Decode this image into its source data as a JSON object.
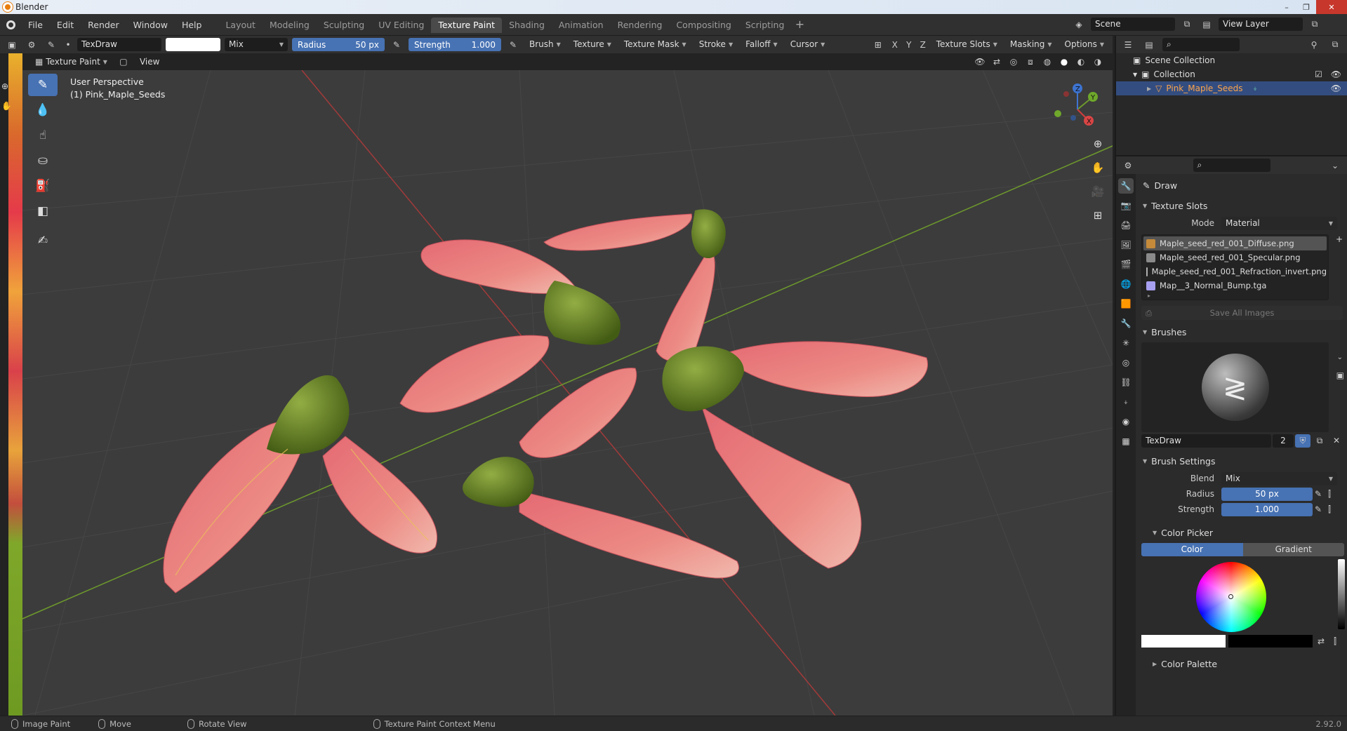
{
  "window": {
    "title": "Blender",
    "controls": [
      "–",
      "❐",
      "✕"
    ]
  },
  "menubar": {
    "menus": [
      "File",
      "Edit",
      "Render",
      "Window",
      "Help"
    ],
    "workspaces": [
      "Layout",
      "Modeling",
      "Sculpting",
      "UV Editing",
      "Texture Paint",
      "Shading",
      "Animation",
      "Rendering",
      "Compositing",
      "Scripting"
    ],
    "active_workspace": "Texture Paint",
    "add_tab": "+",
    "scene_label": "Scene",
    "view_layer_label": "View Layer"
  },
  "toolheader": {
    "brush_name": "TexDraw",
    "blend_mode": "Mix",
    "radius_label": "Radius",
    "radius_value": "50 px",
    "strength_label": "Strength",
    "strength_value": "1.000",
    "brush_menu": "Brush",
    "texture_menu": "Texture",
    "texture_mask_menu": "Texture Mask",
    "stroke_menu": "Stroke",
    "falloff_menu": "Falloff",
    "cursor_menu": "Cursor",
    "axis_x": "X",
    "axis_y": "Y",
    "axis_z": "Z",
    "texture_slots_menu": "Texture Slots",
    "masking_menu": "Masking",
    "options_menu": "Options"
  },
  "viewport_header": {
    "mode": "Texture Paint",
    "view_menu": "View"
  },
  "viewport": {
    "perspective": "User Perspective",
    "object_info": "(1) Pink_Maple_Seeds",
    "gizmo_x": "X",
    "gizmo_y": "Y",
    "gizmo_z": "Z",
    "colors": {
      "bg": "#3c3c3c",
      "grid": "#454545",
      "x_axis": "#a33a3a",
      "y_axis": "#6e9a2c",
      "wing": "#e8727a",
      "wing_edge": "#f2b3a8",
      "seed": "#5e7a22",
      "vein": "#e9c05a"
    }
  },
  "tools": [
    "draw-brush-icon",
    "soften-icon",
    "smear-icon",
    "clone-stamp-icon",
    "fill-bucket-icon",
    "mask-icon",
    "annotate-icon"
  ],
  "outliner": {
    "scene_collection": "Scene Collection",
    "collection": "Collection",
    "object": "Pink_Maple_Seeds"
  },
  "properties": {
    "tool_name": "Draw",
    "texture_slots": {
      "title": "Texture Slots",
      "mode_label": "Mode",
      "mode_value": "Material",
      "slots": [
        "Maple_seed_red_001_Diffuse.png",
        "Maple_seed_red_001_Specular.png",
        "Maple_seed_red_001_Refraction_invert.png",
        "Map__3_Normal_Bump.tga"
      ],
      "slot_colors": [
        "#c58a3a",
        "#8a8a8a",
        "#b0b0b0",
        "#a79ff0"
      ],
      "save_all": "Save All Images"
    },
    "brushes": {
      "title": "Brushes",
      "brush_name": "TexDraw",
      "users": "2"
    },
    "brush_settings": {
      "title": "Brush Settings",
      "blend_label": "Blend",
      "blend_value": "Mix",
      "radius_label": "Radius",
      "radius_value": "50 px",
      "strength_label": "Strength",
      "strength_value": "1.000"
    },
    "color_picker": {
      "title": "Color Picker",
      "tab_color": "Color",
      "tab_gradient": "Gradient"
    },
    "color_palette": {
      "title": "Color Palette"
    }
  },
  "statusbar": {
    "image_paint": "Image Paint",
    "move": "Move",
    "rotate_view": "Rotate View",
    "context_menu": "Texture Paint Context Menu",
    "version": "2.92.0"
  }
}
